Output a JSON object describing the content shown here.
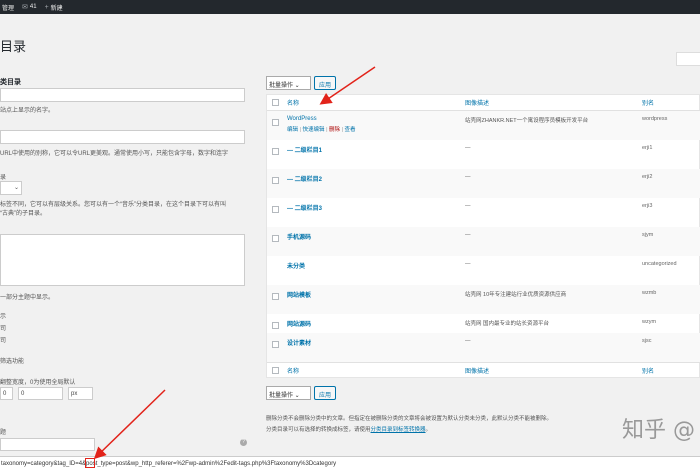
{
  "adminbar": {
    "site_label": "管理",
    "comments_count": "41",
    "new_label": "新建"
  },
  "page": {
    "title": "目录"
  },
  "form": {
    "add_title": "类目录",
    "name_help": "站点上显示的名字。",
    "slug_help": "URL中使用的别称，它可以令URL更美观。通常使用小写，只能包含字母，数字和连字",
    "parent_label": "录",
    "parent_help_1": "标签不同，它可以有层级关系。您可以有一个“音乐”分类目录，在这个目录下可以有叫",
    "parent_help_2": "“古典”的子目录。",
    "desc_help": "一部分主题中显示。",
    "opt_1": "示",
    "opt_2": "司",
    "opt_3": "司",
    "filter_label": "筛选功能",
    "width_label": "翻整宽度，0为使用全局默认",
    "input_a": "0",
    "input_b": "0",
    "unit": "px",
    "bottom_label": "题"
  },
  "table": {
    "bulk_label": "批量操作",
    "apply_label": "应用",
    "headers": {
      "name": "名称",
      "desc": "图像描述",
      "slug": "别名"
    },
    "rows": [
      {
        "name": "WordPress",
        "desc": "站壳网ZHANKR.NET一个寓设程序员模板开发平台",
        "slug": "wordpress",
        "actions": {
          "edit": "编辑",
          "quick": "快速编辑",
          "delete": "删除",
          "view": "查看"
        }
      },
      {
        "name": "— 二级栏目1",
        "desc": "—",
        "slug": "erji1"
      },
      {
        "name": "— 二级栏目2",
        "desc": "—",
        "slug": "erji2"
      },
      {
        "name": "— 二级栏目3",
        "desc": "—",
        "slug": "erji3"
      },
      {
        "name": "手机源码",
        "desc": "—",
        "slug": "sjym"
      },
      {
        "name": "未分类",
        "desc": "—",
        "slug": "uncategorized"
      },
      {
        "name": "网站模板",
        "desc": "站壳网 10年专注建站行业优质资源供应商",
        "slug": "wzmb"
      },
      {
        "name": "网站源码",
        "desc": "站壳网 国内最专业的站长资源平台",
        "slug": "wzym"
      },
      {
        "name": "设计素材",
        "desc": "—",
        "slug": "sjsc"
      }
    ]
  },
  "notes": {
    "line1": "删除分类不会删除分类中的文章。但指定在被删除分类的文章将会被设置为默认分类未分类，此默认分类不能被删除。",
    "line2_prefix": "分类目录可以有选择的转换成标签，请使用",
    "line2_link": "分类目录到标签转换器",
    "line2_suffix": "。"
  },
  "statusbar": {
    "url": "taxonomy=category&tag_ID=4&post_type=post&wp_http_referer=%2Fwp-admin%2Fedit-tags.php%3Ftaxonomy%3Dcategory"
  },
  "watermark": {
    "text": "知乎 @"
  },
  "colors": {
    "adminbar": "#23282d",
    "link": "#0073aa",
    "delete": "#a00",
    "annotation": "#e2231a"
  }
}
